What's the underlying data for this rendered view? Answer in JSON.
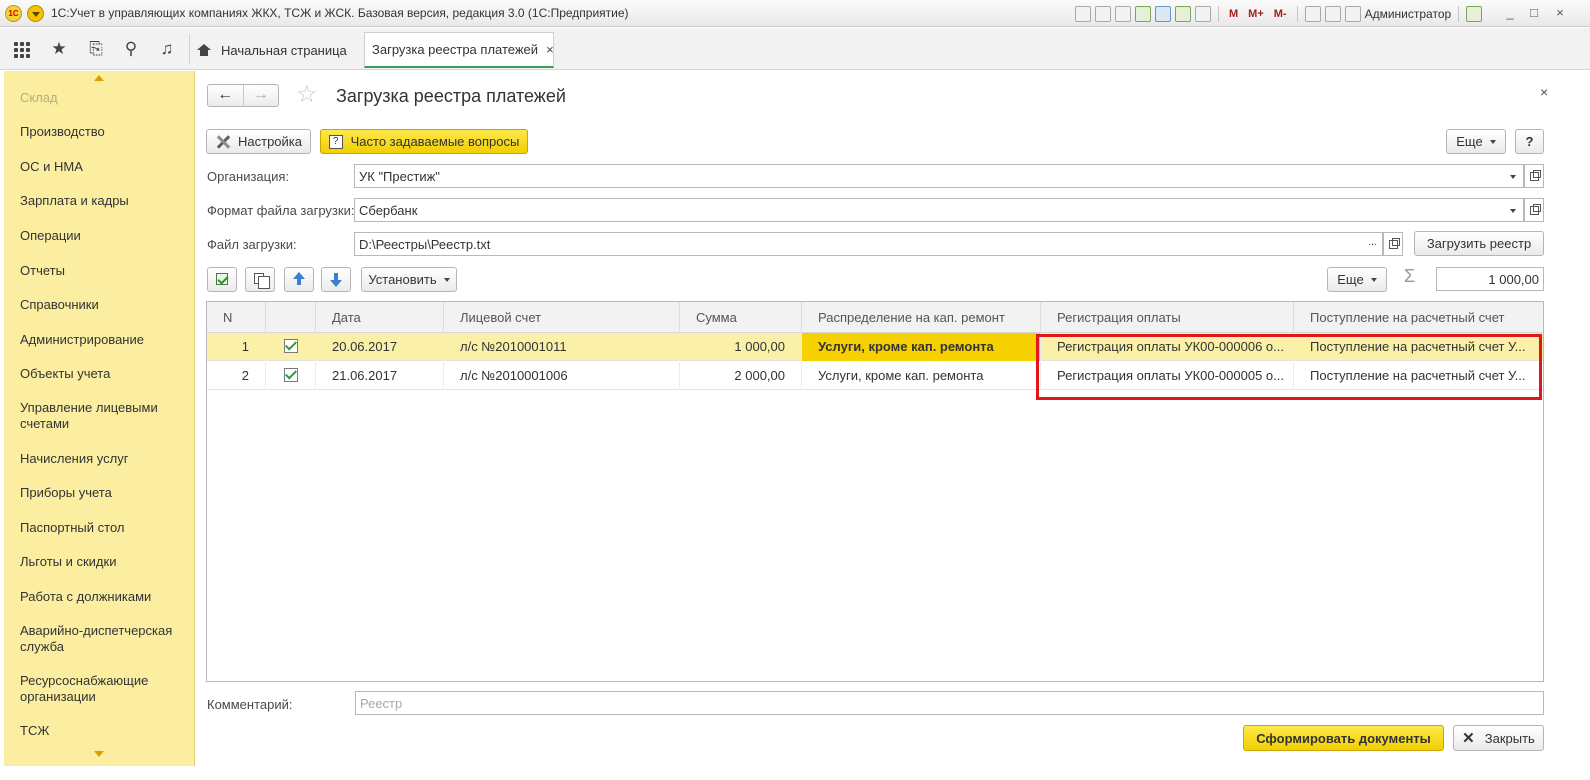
{
  "window": {
    "logo_text": "1С",
    "title": "1С:Учет в управляющих компаниях ЖКХ, ТСЖ и ЖСК. Базовая версия, редакция 3.0  (1С:Предприятие)",
    "toolbar_text": [
      "M",
      "M+",
      "M-"
    ],
    "user": "Администратор",
    "controls": [
      "_",
      "□",
      "×"
    ]
  },
  "top_panel": {
    "icons": [
      "apps-grid-icon",
      "star-icon",
      "history-icon",
      "search-icon",
      "bell-icon"
    ],
    "tabs": [
      {
        "label": "Начальная страница",
        "active": false
      },
      {
        "label": "Загрузка реестра платежей",
        "active": true
      }
    ],
    "tab_close": "×"
  },
  "sidebar": {
    "items": [
      "Склад",
      "Производство",
      "ОС и НМА",
      "Зарплата и кадры",
      "Операции",
      "Отчеты",
      "Справочники",
      "Администрирование",
      "Объекты учета",
      "Управление лицевыми счетами",
      "Начисления услуг",
      "Приборы учета",
      "Паспортный стол",
      "Льготы и скидки",
      "Работа с должниками",
      "Аварийно-диспетчерская служба",
      "Ресурсоснабжающие организации",
      "ТСЖ"
    ]
  },
  "form": {
    "title": "Загрузка реестра платежей",
    "nav_back": "←",
    "nav_forward": "→",
    "star": "☆",
    "close": "×",
    "settings_button": "Настройка",
    "faq_button": "Часто задаваемые вопросы",
    "faq_icon": "?",
    "more_button": "Еще",
    "help_button": "?",
    "organization_label": "Организация:",
    "organization_value": "УК \"Престиж\"",
    "format_label": "Формат файла загрузки:",
    "format_value": "Сбербанк",
    "file_label": "Файл загрузки:",
    "file_value": "D:\\Реестры\\Реестр.txt",
    "file_select": "...",
    "load_button": "Загрузить реестр",
    "set_button": "Установить",
    "table_more_button": "Еще",
    "sigma": "Σ",
    "total": "1 000,00",
    "comment_label": "Комментарий:",
    "comment_placeholder": "Реестр",
    "generate_button": "Сформировать документы",
    "close_button": "Закрыть",
    "close_icon": "✕"
  },
  "table": {
    "columns": [
      "N",
      "",
      "Дата",
      "Лицевой счет",
      "Сумма",
      "Распределение на кап. ремонт",
      "Регистрация оплаты",
      "Поступление на расчетный счет"
    ],
    "rows": [
      {
        "n": "1",
        "checked": true,
        "date": "20.06.2017",
        "account": "л/с №2010001011",
        "sum": "1 000,00",
        "distribution": "Услуги, кроме кап. ремонта",
        "registration": "Регистрация оплаты УК00-000006 о...",
        "receipt": "Поступление на расчетный счет У..."
      },
      {
        "n": "2",
        "checked": true,
        "date": "21.06.2017",
        "account": "л/с №2010001006",
        "sum": "2 000,00",
        "distribution": "Услуги, кроме кап. ремонта",
        "registration": "Регистрация оплаты УК00-000005 о...",
        "receipt": "Поступление на расчетный счет У..."
      }
    ]
  },
  "colors": {
    "sidebar_bg": "#fbeea0",
    "selected_row": "#fbf0a8",
    "current_cell": "#f6d000",
    "highlight_border": "#e0161d",
    "primary_button": "#f1cf00"
  }
}
